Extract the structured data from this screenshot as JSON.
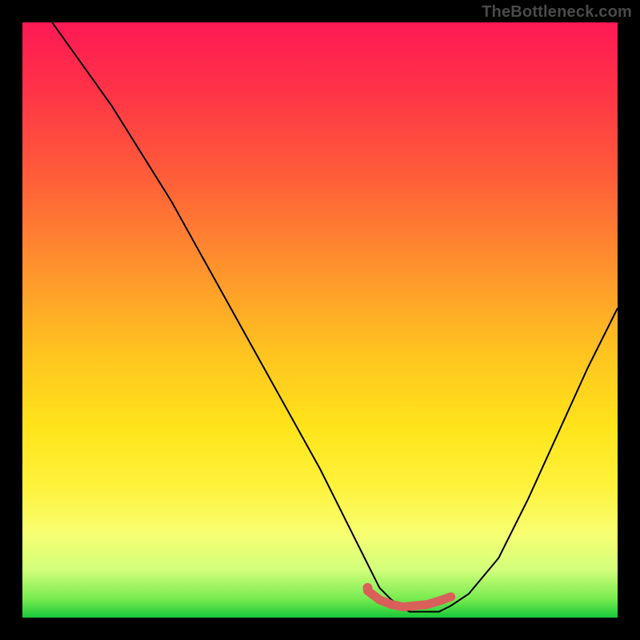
{
  "watermark": "TheBottleneck.com",
  "chart_data": {
    "type": "line",
    "title": "",
    "xlabel": "",
    "ylabel": "",
    "xlim": [
      0,
      100
    ],
    "ylim": [
      0,
      100
    ],
    "series": [
      {
        "name": "curve",
        "x": [
          5,
          10,
          15,
          20,
          25,
          30,
          35,
          40,
          45,
          50,
          55,
          58,
          60,
          62,
          65,
          68,
          70,
          72,
          75,
          80,
          85,
          90,
          95,
          100
        ],
        "y": [
          100,
          93,
          86,
          78,
          70,
          61,
          52,
          43,
          34,
          25,
          15,
          9,
          5,
          3,
          1,
          1,
          1,
          2,
          4,
          10,
          20,
          31,
          42,
          52
        ]
      },
      {
        "name": "highlight",
        "x": [
          58,
          60,
          62,
          64,
          66,
          68,
          70,
          72
        ],
        "y": [
          4.5,
          3,
          2.2,
          1.8,
          2,
          2.2,
          2.8,
          3.5
        ]
      }
    ],
    "highlight_marker": {
      "x": 58,
      "y": 5
    },
    "colors": {
      "curve": "#000000",
      "highlight": "#d9605a",
      "gradient_top": "#ff1a55",
      "gradient_bottom": "#18c93a"
    }
  }
}
